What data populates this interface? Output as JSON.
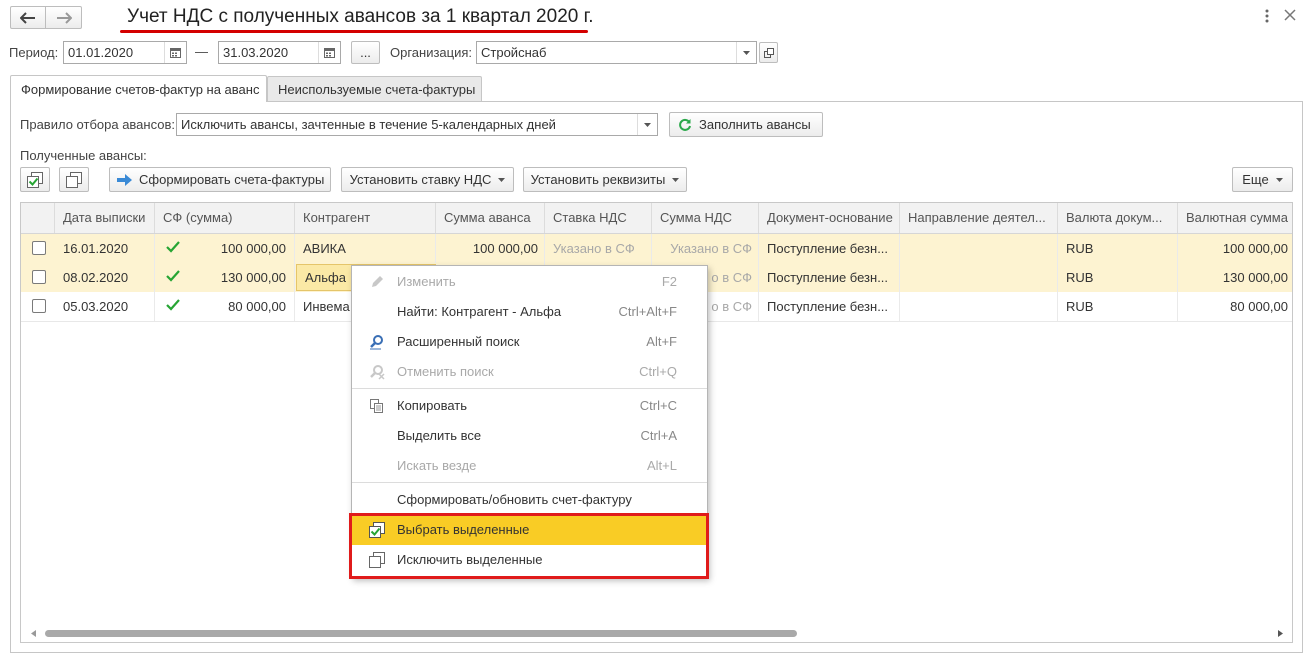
{
  "header": {
    "title": "Учет НДС с полученных авансов за 1 квартал 2020 г.",
    "nav_back_icon": "arrow-left-icon",
    "nav_forward_icon": "arrow-right-icon",
    "more_icon": "vertical-dots-icon",
    "close_icon": "close-icon",
    "title_underline_color": "#d40000"
  },
  "period": {
    "label": "Период:",
    "from": "01.01.2020",
    "dash": "—",
    "to": "31.03.2020",
    "picker_label": "...",
    "org_label": "Организация:",
    "org_value": "Стройснаб"
  },
  "tabs": [
    {
      "label": "Формирование счетов-фактур на аванс",
      "active": true
    },
    {
      "label": "Неиспользуемые счета-фактуры",
      "active": false
    }
  ],
  "rule": {
    "label": "Правило отбора авансов:",
    "value": "Исключить авансы, зачтенные в течение 5-календарных дней",
    "fill_button": "Заполнить авансы"
  },
  "received_label": "Полученные авансы:",
  "toolbar": {
    "form_invoices": "Сформировать счета-фактуры",
    "set_rate": "Установить ставку НДС",
    "set_details": "Установить реквизиты",
    "more": "Еще"
  },
  "table": {
    "columns": [
      "Дата выписки",
      "СФ (сумма)",
      "Контрагент",
      "Сумма аванса",
      "Ставка НДС",
      "Сумма НДС",
      "Документ-основание",
      "Направление деятел...",
      "Валюта докум...",
      "Валютная сумма"
    ],
    "rows": [
      {
        "date": "16.01.2020",
        "sf_checked": true,
        "sf_sum": "100 000,00",
        "counterparty": "АВИКА",
        "advance": "100 000,00",
        "rate": "Указано в СФ",
        "vat": "Указано в СФ",
        "doc": "Поступление безн...",
        "direction": "",
        "currency": "RUB",
        "cur_sum": "100 000,00"
      },
      {
        "date": "08.02.2020",
        "sf_checked": true,
        "sf_sum": "130 000,00",
        "counterparty": "Альфа",
        "advance": "",
        "rate": "",
        "vat": "о в СФ",
        "doc": "Поступление безн...",
        "direction": "",
        "currency": "RUB",
        "cur_sum": "130 000,00"
      },
      {
        "date": "05.03.2020",
        "sf_checked": true,
        "sf_sum": "80 000,00",
        "counterparty": "Инвема",
        "advance": "",
        "rate": "",
        "vat": "о в СФ",
        "doc": "Поступление безн...",
        "direction": "",
        "currency": "RUB",
        "cur_sum": "80 000,00"
      }
    ]
  },
  "context_menu": {
    "items": [
      {
        "label": "Изменить",
        "shortcut": "F2",
        "icon": "pencil-icon",
        "disabled": true
      },
      {
        "label": "Найти: Контрагент - Альфа",
        "shortcut": "Ctrl+Alt+F",
        "icon": "",
        "disabled": false
      },
      {
        "label": "Расширенный поиск",
        "shortcut": "Alt+F",
        "icon": "search-icon",
        "disabled": false
      },
      {
        "label": "Отменить поиск",
        "shortcut": "Ctrl+Q",
        "icon": "cancel-search-icon",
        "disabled": true
      },
      {
        "label": "Копировать",
        "shortcut": "Ctrl+C",
        "icon": "copy-icon",
        "disabled": false
      },
      {
        "label": "Выделить все",
        "shortcut": "Ctrl+A",
        "icon": "",
        "disabled": false
      },
      {
        "label": "Искать везде",
        "shortcut": "Alt+L",
        "icon": "",
        "disabled": true
      },
      {
        "label": "Сформировать/обновить счет-фактуру",
        "shortcut": "",
        "icon": "",
        "disabled": false
      },
      {
        "label": "Выбрать выделенные",
        "shortcut": "",
        "icon": "check-all-icon",
        "disabled": false
      },
      {
        "label": "Исключить выделенные",
        "shortcut": "",
        "icon": "uncheck-all-icon",
        "disabled": false
      }
    ],
    "highlight_color": "#f9cc25",
    "annotation_color": "#e01b1b"
  },
  "colors": {
    "row_highlight": "#fdf3d1",
    "check_green": "#27a534",
    "refresh_green": "#2aa84a",
    "form_arrow_blue": "#3a8ad6"
  }
}
